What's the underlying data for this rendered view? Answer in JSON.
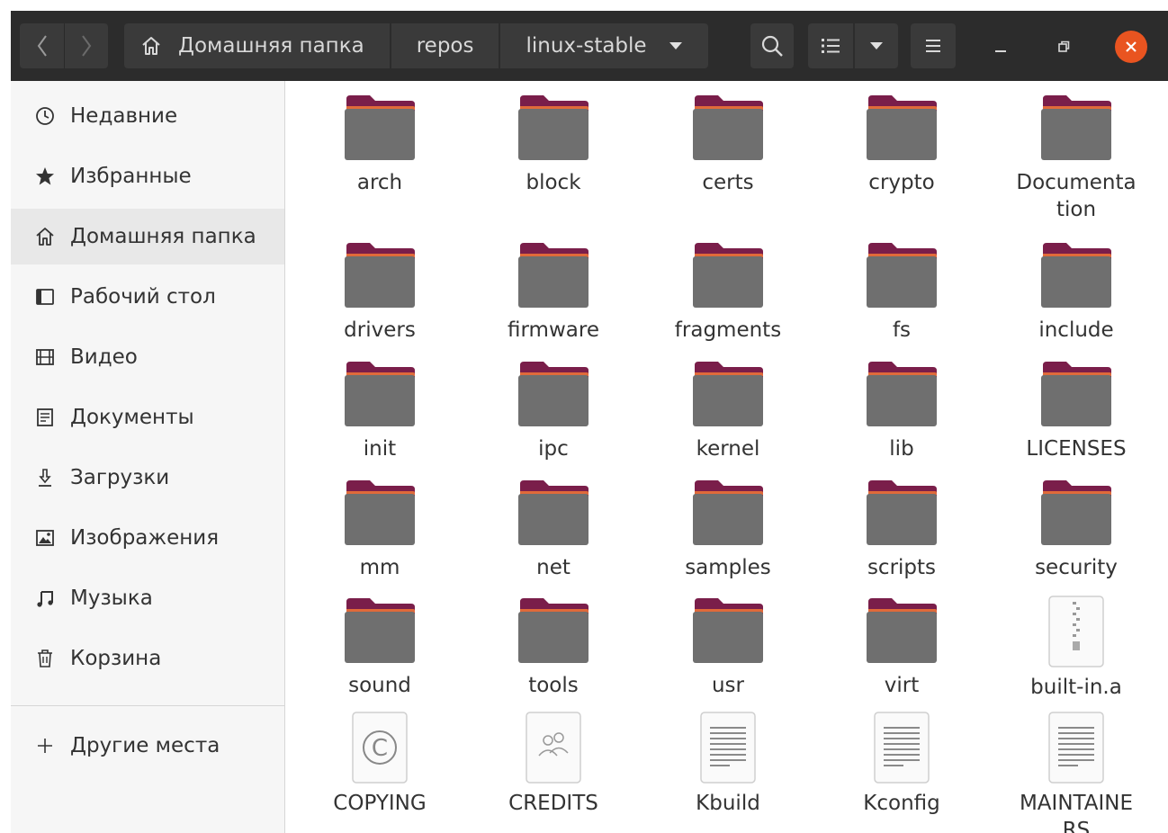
{
  "toolbar": {
    "back_icon": "chevron-left-icon",
    "forward_icon": "chevron-right-icon",
    "search_icon": "search-icon",
    "view_icon": "list-view-icon",
    "view_dropdown_icon": "caret-down-icon",
    "menu_icon": "hamburger-menu-icon",
    "minimize_icon": "minimize-icon",
    "restore_icon": "restore-icon",
    "close_icon": "close-icon",
    "close_color": "#e95420"
  },
  "path": {
    "crumbs": [
      {
        "label": "Домашняя папка",
        "icon": "home-icon"
      },
      {
        "label": "repos"
      },
      {
        "label": "linux-stable",
        "icon": "caret-down-icon"
      }
    ]
  },
  "sidebar": {
    "items": [
      {
        "label": "Недавние",
        "icon": "clock-icon"
      },
      {
        "label": "Избранные",
        "icon": "star-icon"
      },
      {
        "label": "Домашняя папка",
        "icon": "home-icon",
        "active": true
      },
      {
        "label": "Рабочий стол",
        "icon": "desktop-icon"
      },
      {
        "label": "Видео",
        "icon": "film-icon"
      },
      {
        "label": "Документы",
        "icon": "document-icon"
      },
      {
        "label": "Загрузки",
        "icon": "download-icon"
      },
      {
        "label": "Изображения",
        "icon": "image-icon"
      },
      {
        "label": "Музыка",
        "icon": "music-icon"
      },
      {
        "label": "Корзина",
        "icon": "trash-icon"
      }
    ],
    "other_places": {
      "label": "Другие места",
      "icon": "plus-icon"
    }
  },
  "colors": {
    "folder_body": "#6f6f6f",
    "folder_tab": "#7a1e4a",
    "folder_top": "#e06a3a",
    "header": "#2c2c2c"
  },
  "files": [
    {
      "name": "arch",
      "type": "folder"
    },
    {
      "name": "block",
      "type": "folder"
    },
    {
      "name": "certs",
      "type": "folder"
    },
    {
      "name": "crypto",
      "type": "folder"
    },
    {
      "name": "Documentation",
      "type": "folder",
      "lines": [
        "Documenta",
        "tion"
      ]
    },
    {
      "name": "drivers",
      "type": "folder"
    },
    {
      "name": "firmware",
      "type": "folder"
    },
    {
      "name": "fragments",
      "type": "folder"
    },
    {
      "name": "fs",
      "type": "folder"
    },
    {
      "name": "include",
      "type": "folder"
    },
    {
      "name": "init",
      "type": "folder"
    },
    {
      "name": "ipc",
      "type": "folder"
    },
    {
      "name": "kernel",
      "type": "folder"
    },
    {
      "name": "lib",
      "type": "folder"
    },
    {
      "name": "LICENSES",
      "type": "folder"
    },
    {
      "name": "mm",
      "type": "folder"
    },
    {
      "name": "net",
      "type": "folder"
    },
    {
      "name": "samples",
      "type": "folder"
    },
    {
      "name": "scripts",
      "type": "folder"
    },
    {
      "name": "security",
      "type": "folder"
    },
    {
      "name": "sound",
      "type": "folder"
    },
    {
      "name": "tools",
      "type": "folder"
    },
    {
      "name": "usr",
      "type": "folder"
    },
    {
      "name": "virt",
      "type": "folder"
    },
    {
      "name": "built-in.a",
      "type": "archive"
    },
    {
      "name": "COPYING",
      "type": "copyright"
    },
    {
      "name": "CREDITS",
      "type": "people"
    },
    {
      "name": "Kbuild",
      "type": "text"
    },
    {
      "name": "Kconfig",
      "type": "text"
    },
    {
      "name": "MAINTAINERS",
      "type": "text",
      "lines": [
        "MAINTAINE",
        "RS"
      ]
    }
  ]
}
